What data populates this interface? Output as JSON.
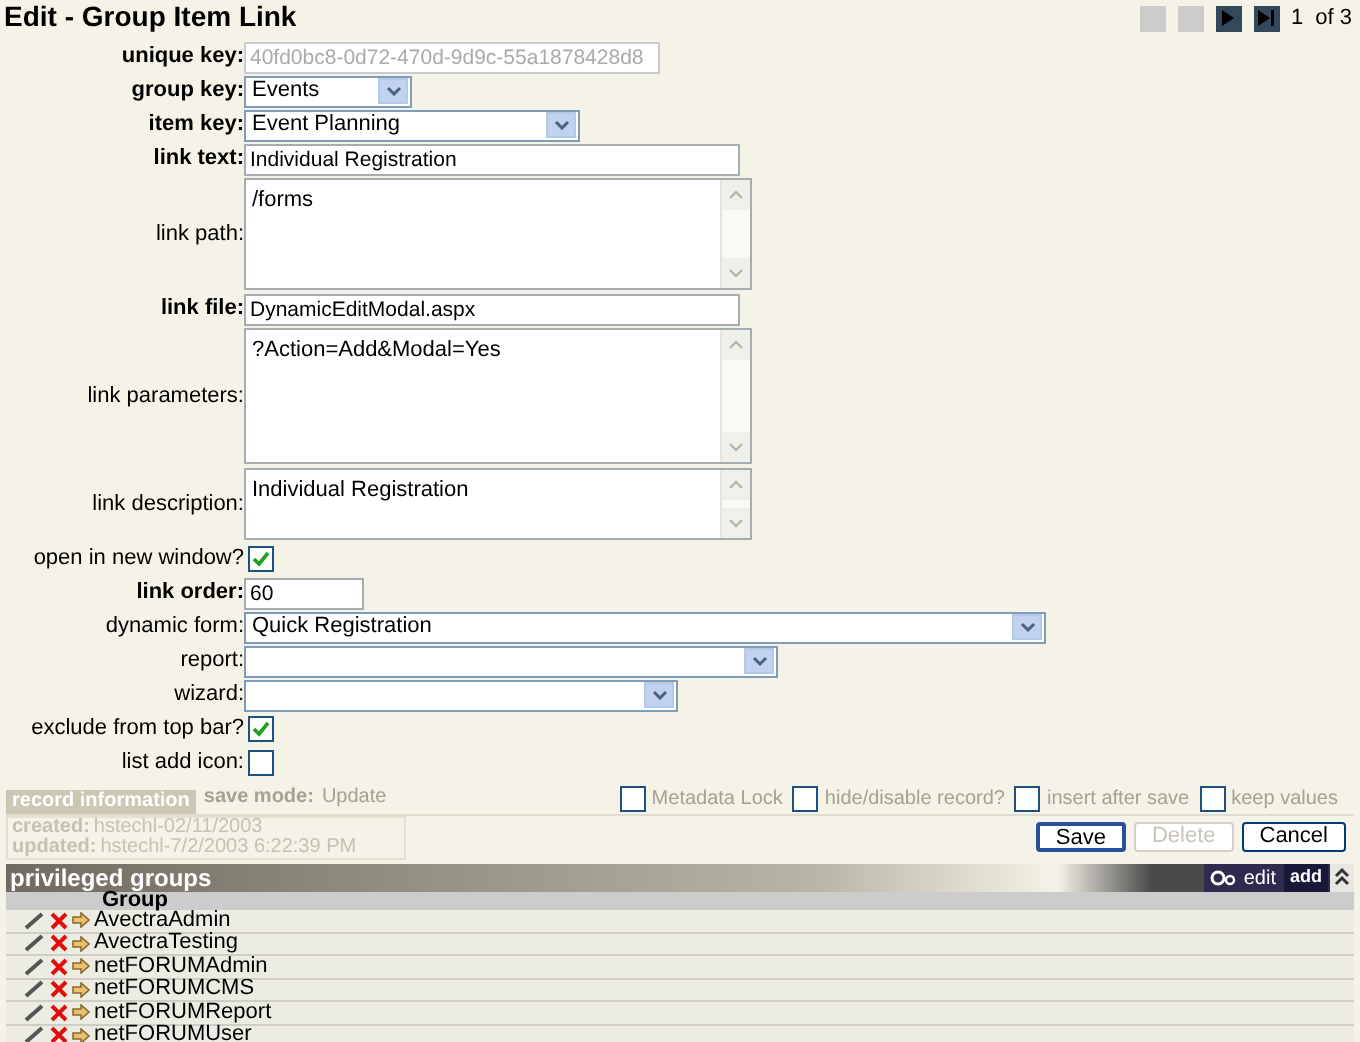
{
  "title": "Edit - Group Item Link",
  "pager": {
    "page": "1",
    "of": "of 3"
  },
  "fields": [
    {
      "kind": "text",
      "label": "unique key:",
      "bold": true,
      "value": "40fd0bc8-0d72-470d-9d9c-55a1878428d8",
      "disabled": true
    },
    {
      "kind": "select",
      "label": "group key:",
      "bold": true,
      "value": "Events"
    },
    {
      "kind": "select",
      "label": "item key:",
      "bold": true,
      "value": "Event Planning"
    },
    {
      "kind": "text",
      "label": "link text:",
      "bold": true,
      "value": "Individual Registration",
      "disabled": false
    },
    {
      "kind": "textarea",
      "label": "link path:",
      "bold": false,
      "value": "/forms"
    },
    {
      "kind": "text",
      "label": "link file:",
      "bold": true,
      "value": "DynamicEditModal.aspx",
      "disabled": false
    },
    {
      "kind": "textarea",
      "label": "link parameters:",
      "bold": false,
      "value": "?Action=Add&Modal=Yes"
    },
    {
      "kind": "textarea",
      "label": "link description:",
      "bold": false,
      "value": "Individual Registration"
    },
    {
      "kind": "checkbox",
      "label": "open in new window?",
      "bold": false,
      "checked": true
    },
    {
      "kind": "text",
      "label": "link order:",
      "bold": true,
      "value": "60",
      "disabled": false
    },
    {
      "kind": "select",
      "label": "dynamic form:",
      "bold": false,
      "value": "Quick Registration"
    },
    {
      "kind": "select",
      "label": "report:",
      "bold": false
    },
    {
      "kind": "select",
      "label": "wizard:",
      "bold": false
    },
    {
      "kind": "checkbox",
      "label": "exclude from top bar?",
      "bold": false,
      "checked": true
    },
    {
      "kind": "checkbox",
      "label": "list add icon:",
      "bold": false,
      "checked": false
    }
  ],
  "record": {
    "tab": "record information",
    "save_mode_label": "save mode:",
    "save_mode": "Update",
    "options": [
      {
        "label": "Metadata Lock",
        "checked": false
      },
      {
        "label": "hide/disable record?",
        "checked": false
      },
      {
        "label": "insert after save",
        "checked": false
      },
      {
        "label": "keep values",
        "checked": false
      }
    ],
    "created_label": "created:",
    "created": "hstechl-02/11/2003",
    "updated_label": "updated:",
    "updated": "hstechl-7/2/2003 6:22:39 PM",
    "buttons": [
      {
        "label": "Save",
        "disabled": false,
        "selected": true
      },
      {
        "label": "Delete",
        "disabled": true,
        "selected": false
      },
      {
        "label": "Cancel",
        "disabled": false,
        "selected": false
      }
    ]
  },
  "groups": {
    "title": "privileged groups",
    "edit": "edit",
    "add": "add",
    "column": "Group",
    "rows": [
      "AvectraAdmin",
      "AvectraTesting",
      "netFORUMAdmin",
      "netFORUMCMS",
      "netFORUMReport",
      "netFORUMUser"
    ]
  }
}
